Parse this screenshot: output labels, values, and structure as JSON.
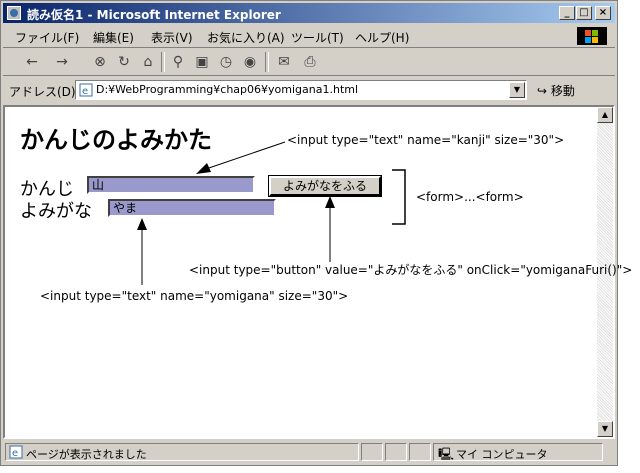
{
  "window": {
    "title": "読み仮名1 - Microsoft Internet Explorer",
    "minimize_glyph": "_",
    "maximize_glyph": "□",
    "close_glyph": "×"
  },
  "menu": [
    "ファイル(F)",
    "編集(E)",
    "表示(V)",
    "お気に入り(A)",
    "ツール(T)",
    "ヘルプ(H)"
  ],
  "toolbar": {
    "icons": [
      "back-icon",
      "forward-icon",
      "stop-icon",
      "refresh-icon",
      "home-icon",
      "search-icon",
      "favorites-icon",
      "history-icon",
      "media-icon",
      "mail-icon",
      "print-icon"
    ]
  },
  "address": {
    "label": "アドレス(D)",
    "url": "D:¥WebProgramming¥chap06¥yomigana1.html",
    "go_label": "移動"
  },
  "page": {
    "heading": "かんじのよみかた",
    "kanji_label": "かんじ",
    "kanji_value": "山",
    "yomigana_label": "よみがな",
    "yomigana_value": "やま",
    "button_label": "よみがなをふる"
  },
  "annotations": {
    "kanji_input": "<input type=\"text\" name=\"kanji\" size=\"30\">",
    "form": "<form>...<form>",
    "button": "<input type=\"button\" value=\"よみがなをふる\" onClick=\"yomiganaFuri()\">",
    "yomigana_input": "<input type=\"text\" name=\"yomigana\" size=\"30\">"
  },
  "status": {
    "text": "ページが表示されました",
    "zone": "マイ コンピュータ"
  },
  "colors": {
    "title_start": "#0a246a",
    "title_end": "#a6caf0",
    "input_fill": "#9999cc",
    "chrome": "#d4d0c8"
  }
}
